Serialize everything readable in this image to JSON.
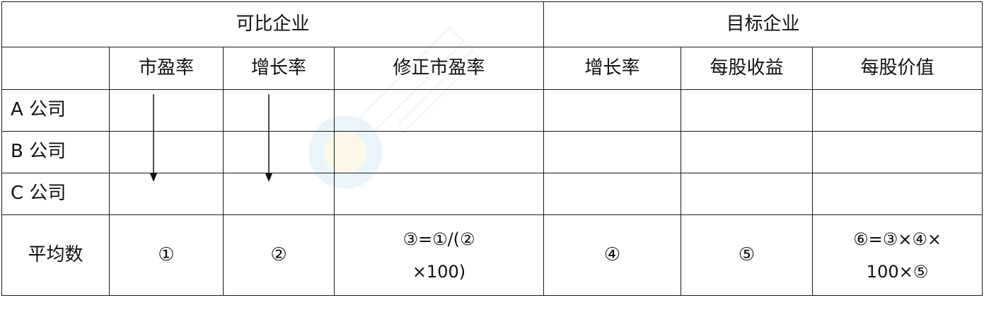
{
  "header": {
    "comparable": "可比企业",
    "target": "目标企业"
  },
  "columns": {
    "pe": "市盈率",
    "growth": "增长率",
    "adjusted_pe": "修正市盈率",
    "target_growth": "增长率",
    "eps": "每股收益",
    "value_per_share": "每股价值"
  },
  "rows": {
    "a": "A 公司",
    "b": "B 公司",
    "c": "C 公司",
    "avg": "平均数"
  },
  "avg": {
    "pe": "①",
    "growth": "②",
    "adjusted_pe_line1": "③=①/(②",
    "adjusted_pe_line2": "×100)",
    "target_growth": "④",
    "eps": "⑤",
    "value_line1": "⑥=③×④×",
    "value_line2": "100×⑤"
  }
}
